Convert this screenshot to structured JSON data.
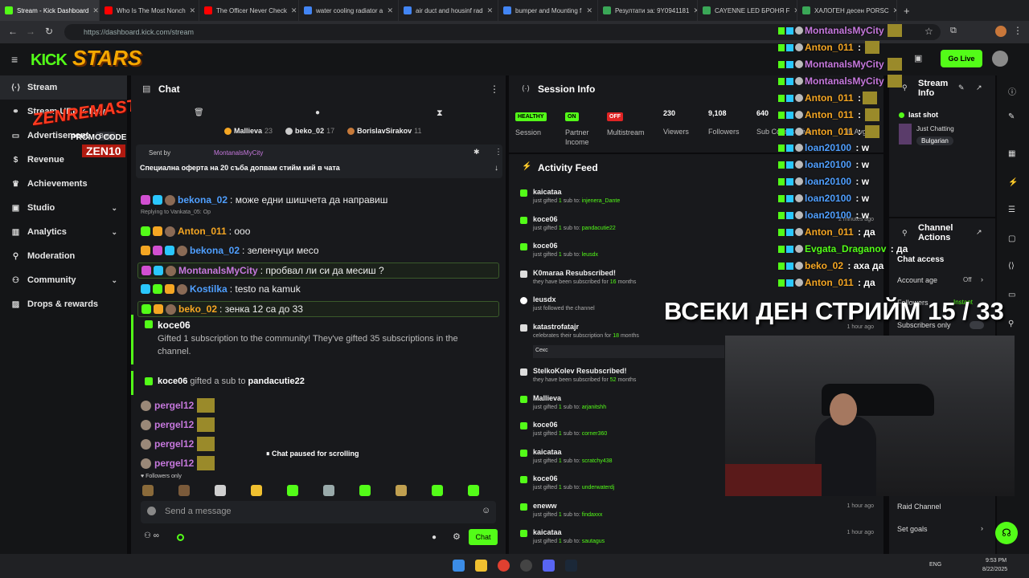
{
  "browser": {
    "tabs": [
      {
        "title": "Stream - Kick Dashboard",
        "color": "#53fc18"
      },
      {
        "title": "Who Is The Most Nonch",
        "color": "#ff0000"
      },
      {
        "title": "The Officer Never Check",
        "color": "#ff0000"
      },
      {
        "title": "water cooling radiator a",
        "color": "#4285f4"
      },
      {
        "title": "air duct and housinf rad",
        "color": "#4285f4"
      },
      {
        "title": "bumper and Mounting f",
        "color": "#4285f4"
      },
      {
        "title": "Резултати за: 9Y0941181",
        "color": "#3aa757"
      },
      {
        "title": "CAYENNE LED БРОНЯ F",
        "color": "#3aa757"
      },
      {
        "title": "ХАЛОГЕН десен PORSC",
        "color": "#3aa757"
      }
    ],
    "url": "https://dashboard.kick.com/stream"
  },
  "brand": {
    "logo": "KICK",
    "stars": "STARS",
    "zenre": "ZENREMASTA",
    "promo_label": "PROMO CODE",
    "promo_code": "ZEN10",
    "go_live": "Go Live"
  },
  "sidebar": {
    "items": [
      {
        "label": "Stream",
        "icon": "stream-icon",
        "selected": true,
        "chevron": false
      },
      {
        "label": "Stream URL & Key",
        "icon": "link-icon",
        "chevron": false
      },
      {
        "label": "Advertisement",
        "icon": "ad-icon",
        "badge": "Beta",
        "chevron": false
      },
      {
        "label": "Revenue",
        "icon": "dollar-icon",
        "chevron": false
      },
      {
        "label": "Achievements",
        "icon": "trophy-icon",
        "chevron": false
      },
      {
        "label": "Studio",
        "icon": "studio-icon",
        "chevron": true
      },
      {
        "label": "Analytics",
        "icon": "chart-icon",
        "chevron": true
      },
      {
        "label": "Moderation",
        "icon": "wrench-icon",
        "chevron": false
      },
      {
        "label": "Community",
        "icon": "users-icon",
        "chevron": true
      },
      {
        "label": "Drops & rewards",
        "icon": "gift-icon",
        "chevron": false
      }
    ]
  },
  "chat": {
    "title": "Chat",
    "leaderboard": [
      {
        "name": "Mallieva",
        "count": "23"
      },
      {
        "name": "beko_02",
        "count": "17"
      },
      {
        "name": "BorislavSirakov",
        "count": "11"
      }
    ],
    "pinned": {
      "sent_by": "Sent by",
      "author": "MontanalsMyCity",
      "text": "Специална оферта на 20 съба допвам стийм кий в чата"
    },
    "messages": [
      {
        "user": "bekona_02",
        "color": "#4f9fff",
        "text": ": може едни шишчета да направиш"
      },
      {
        "reply": "Replying to Vankata_05: Op"
      },
      {
        "user": "Anton_011",
        "color": "#f5a623",
        "text": ": ооо"
      },
      {
        "user": "bekona_02",
        "color": "#4f9fff",
        "text": ": зеленчуци месо"
      },
      {
        "user": "MontanalsMyCity",
        "color": "#c678dd",
        "text": ": пробвал ли си да месиш ?",
        "highlight": true
      },
      {
        "user": "Kostilka",
        "color": "#4f9fff",
        "text": ": testo na kamuk"
      },
      {
        "user": "beko_02",
        "color": "#f5a623",
        "text": ": зенка 12 са до 33",
        "highlight": true
      }
    ],
    "gift_event": {
      "user": "koce06",
      "text": "Gifted 1 subscription to the community! They've gifted 35 subscriptions in the channel."
    },
    "gift_sub": {
      "user": "koce06",
      "mid": " gifted a sub to ",
      "target": "pandacutie22"
    },
    "spam": [
      {
        "user": "pergel12"
      },
      {
        "user": "pergel12"
      },
      {
        "user": "pergel12"
      },
      {
        "user": "pergel12"
      }
    ],
    "paused": "Chat paused for scrolling",
    "followers_only": "Followers only",
    "placeholder": "Send a message",
    "send": "Chat"
  },
  "session": {
    "title": "Session Info",
    "stats": [
      {
        "badge": "HEALTHY",
        "badge_color": "#53fc18",
        "label": "Session"
      },
      {
        "badge": "ON",
        "badge_color": "#53fc18",
        "label": "Partner Income"
      },
      {
        "badge": "OFF",
        "badge_color": "#e02424",
        "label": "Multistream"
      },
      {
        "value": "230",
        "label": "Viewers"
      },
      {
        "value": "9,108",
        "label": "Followers"
      },
      {
        "value": "640",
        "label": "Sub Counts"
      },
      {
        "value": "",
        "label": "Live"
      },
      {
        "value": "",
        "label": "In Avg."
      }
    ]
  },
  "activity": {
    "title": "Activity Feed",
    "items": [
      {
        "name": "kaicataa",
        "prefix": "just gifted ",
        "num": "1",
        "mid": " sub to: ",
        "target": "injenera_Dante",
        "time": ""
      },
      {
        "name": "koce06",
        "prefix": "just gifted ",
        "num": "1",
        "mid": " sub to: ",
        "target": "pandacutie22",
        "time": "2 minutes ago"
      },
      {
        "name": "koce06",
        "prefix": "just gifted ",
        "num": "1",
        "mid": " sub to: ",
        "target": "leusdx",
        "time": ""
      },
      {
        "name": "K0maraa Resubscribed!",
        "prefix": "they have been subscribed for ",
        "num": "16",
        "mid": " months",
        "target": "",
        "time": ""
      },
      {
        "name": "leusdx",
        "prefix": "just followed the channel",
        "num": "",
        "mid": "",
        "target": "",
        "time": ""
      },
      {
        "name": "katastrofatajr",
        "prefix": "celebrates their subscription for ",
        "num": "18",
        "mid": " months",
        "target": "",
        "time": "1 hour ago",
        "note": "Секс"
      },
      {
        "name": "StelkoKolev Resubscribed!",
        "prefix": "they have been subscribed for ",
        "num": "52",
        "mid": " months",
        "target": "",
        "time": ""
      },
      {
        "name": "Mallieva",
        "prefix": "just gifted ",
        "num": "1",
        "mid": " sub to: ",
        "target": "arjanitshh",
        "time": ""
      },
      {
        "name": "koce06",
        "prefix": "just gifted ",
        "num": "1",
        "mid": " sub to: ",
        "target": "corner360",
        "time": ""
      },
      {
        "name": "kaicataa",
        "prefix": "just gifted ",
        "num": "1",
        "mid": " sub to: ",
        "target": "scratchy438",
        "time": ""
      },
      {
        "name": "koce06",
        "prefix": "just gifted ",
        "num": "1",
        "mid": " sub to: ",
        "target": "underwaterdj",
        "time": ""
      },
      {
        "name": "eneww",
        "prefix": "just gifted ",
        "num": "1",
        "mid": " sub to: ",
        "target": "findaxxx",
        "time": "1 hour ago"
      },
      {
        "name": "kaicataa",
        "prefix": "just gifted ",
        "num": "1",
        "mid": " sub to: ",
        "target": "sautagus",
        "time": "1 hour ago"
      }
    ]
  },
  "overlay_chat": [
    {
      "user": "MontanalsMyCity",
      "color": "#c678dd",
      "text": ""
    },
    {
      "user": "Anton_011",
      "color": "#f5a623",
      "text": " : "
    },
    {
      "user": "MontanalsMyCity",
      "color": "#c678dd",
      "text": ""
    },
    {
      "user": "MontanalsMyCity",
      "color": "#c678dd",
      "text": ""
    },
    {
      "user": "Anton_011",
      "color": "#f5a623",
      "text": " :"
    },
    {
      "user": "Anton_011",
      "color": "#f5a623",
      "text": " : "
    },
    {
      "user": "Anton_011",
      "color": "#f5a623",
      "text": " : "
    },
    {
      "user": "loan20100",
      "color": "#4f9fff",
      "text": " : w"
    },
    {
      "user": "loan20100",
      "color": "#4f9fff",
      "text": " : w"
    },
    {
      "user": "loan20100",
      "color": "#4f9fff",
      "text": " : w"
    },
    {
      "user": "loan20100",
      "color": "#4f9fff",
      "text": " : w"
    },
    {
      "user": "loan20100",
      "color": "#4f9fff",
      "text": " : w"
    },
    {
      "user": "Anton_011",
      "color": "#f5a623",
      "text": " : да"
    },
    {
      "user": "Evgata_Draganov",
      "color": "#53fc18",
      "text": " : да"
    },
    {
      "user": "beko_02",
      "color": "#f5a623",
      "text": " : аха да"
    },
    {
      "user": "Anton_011",
      "color": "#f5a623",
      "text": " : да"
    }
  ],
  "overlay_banner": "ВСЕКИ ДЕН СТРИЙМ 15 / 33",
  "stream_info": {
    "title": "Stream Info",
    "stream_title": "last shot",
    "category": "Just Chatting",
    "language": "Bulgarian"
  },
  "channel_actions": {
    "title": "Channel Actions",
    "chat_access": "Chat access",
    "account_age": "Account age",
    "account_age_value": "Off",
    "followers": "Followers",
    "followers_value": "Instant",
    "subscribers_only": "Subscribers only",
    "raid": "Raid Channel",
    "goals": "Set goals"
  },
  "taskbar": {
    "lang": "ENG",
    "time": "9:53 PM",
    "date": "8/22/2025"
  }
}
